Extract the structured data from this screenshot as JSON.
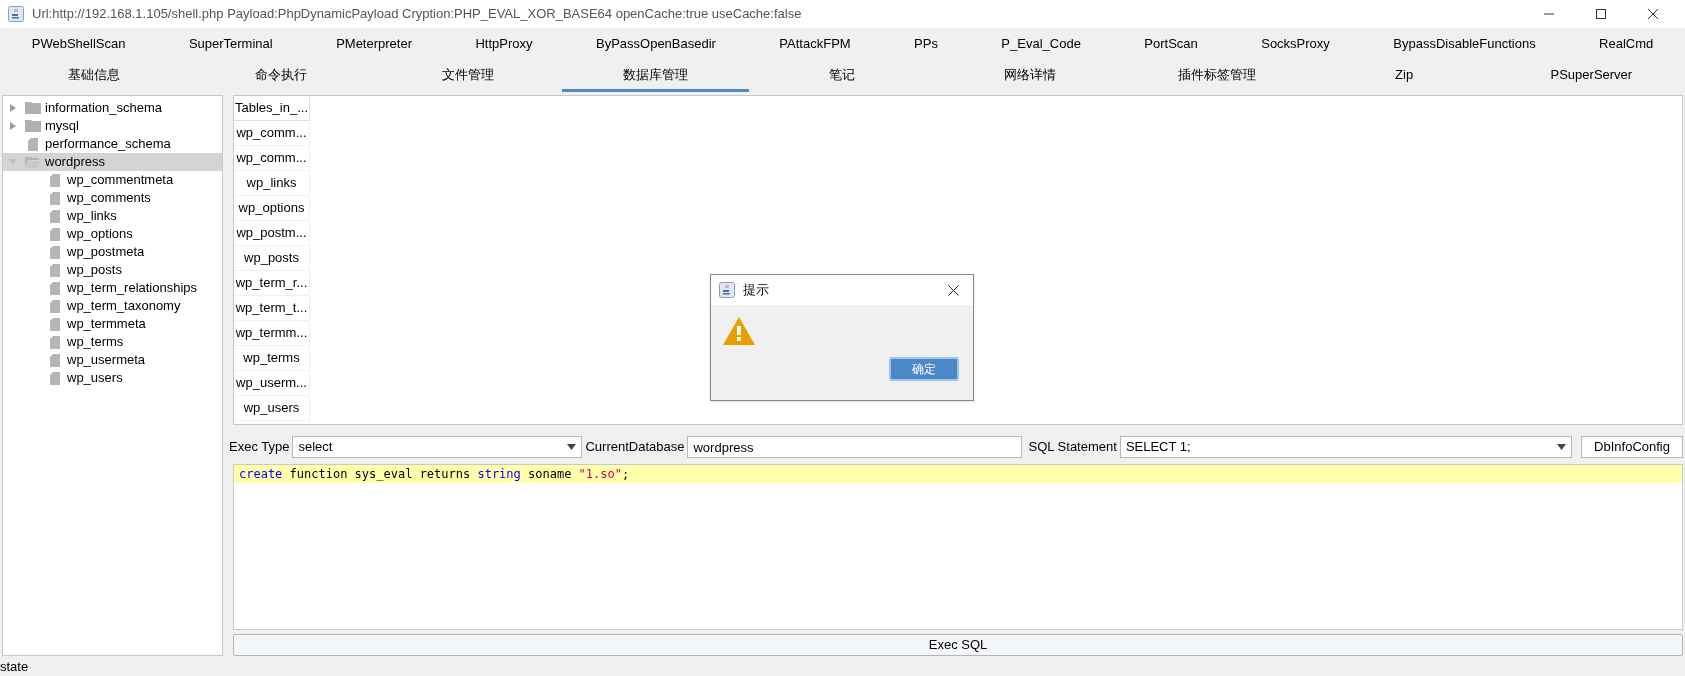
{
  "window": {
    "title": "Url:http://192.168.1.105/shell.php Payload:PhpDynamicPayload Cryption:PHP_EVAL_XOR_BASE64 openCache:true useCache:false"
  },
  "plugin_tabs": [
    {
      "label": "PWebShellScan",
      "selected": false
    },
    {
      "label": "SuperTerminal",
      "selected": false
    },
    {
      "label": "PMeterpreter",
      "selected": false
    },
    {
      "label": "HttpProxy",
      "selected": false
    },
    {
      "label": "ByPassOpenBasedir",
      "selected": false
    },
    {
      "label": "PAttackFPM",
      "selected": false
    },
    {
      "label": "PPs",
      "selected": false
    },
    {
      "label": "P_Eval_Code",
      "selected": false
    },
    {
      "label": "PortScan",
      "selected": false
    },
    {
      "label": "SocksProxy",
      "selected": false
    },
    {
      "label": "BypassDisableFunctions",
      "selected": false
    },
    {
      "label": "RealCmd",
      "selected": false
    }
  ],
  "tabs": [
    {
      "label": "基础信息",
      "selected": false
    },
    {
      "label": "命令执行",
      "selected": false
    },
    {
      "label": "文件管理",
      "selected": false
    },
    {
      "label": "数据库管理",
      "selected": true
    },
    {
      "label": "笔记",
      "selected": false
    },
    {
      "label": "网络详情",
      "selected": false
    },
    {
      "label": "插件标签管理",
      "selected": false
    },
    {
      "label": "Zip",
      "selected": false
    },
    {
      "label": "PSuperServer",
      "selected": false
    }
  ],
  "tree": [
    {
      "label": "information_schema",
      "kind": "folder",
      "expanded": false,
      "selected": false
    },
    {
      "label": "mysql",
      "kind": "folder",
      "expanded": false,
      "selected": false
    },
    {
      "label": "performance_schema",
      "kind": "file",
      "selected": false
    },
    {
      "label": "wordpress",
      "kind": "folder",
      "expanded": true,
      "selected": true,
      "children": [
        {
          "label": "wp_commentmeta",
          "kind": "file",
          "selected": false
        },
        {
          "label": "wp_comments",
          "kind": "file",
          "selected": false
        },
        {
          "label": "wp_links",
          "kind": "file",
          "selected": false
        },
        {
          "label": "wp_options",
          "kind": "file",
          "selected": false
        },
        {
          "label": "wp_postmeta",
          "kind": "file",
          "selected": false
        },
        {
          "label": "wp_posts",
          "kind": "file",
          "selected": false
        },
        {
          "label": "wp_term_relationships",
          "kind": "file",
          "selected": false
        },
        {
          "label": "wp_term_taxonomy",
          "kind": "file",
          "selected": false
        },
        {
          "label": "wp_termmeta",
          "kind": "file",
          "selected": false
        },
        {
          "label": "wp_terms",
          "kind": "file",
          "selected": false
        },
        {
          "label": "wp_usermeta",
          "kind": "file",
          "selected": false
        },
        {
          "label": "wp_users",
          "kind": "file",
          "selected": false
        }
      ]
    }
  ],
  "table": {
    "columns": [
      "Tables_in_..."
    ],
    "rows": [
      "wp_comm...",
      "wp_comm...",
      "wp_links",
      "wp_options",
      "wp_postm...",
      "wp_posts",
      "wp_term_r...",
      "wp_term_t...",
      "wp_termm...",
      "wp_terms",
      "wp_userm...",
      "wp_users"
    ]
  },
  "controls": {
    "exec_type_label": "Exec Type",
    "exec_type": "select",
    "database_label": "CurrentDatabase",
    "database": "wordpress",
    "sql_label": "SQL Statement",
    "sql": "SELECT 1;",
    "config_button": "DbInfoConfig"
  },
  "editor": {
    "tokens": [
      {
        "text": "create",
        "kind": "keyword"
      },
      {
        "text": " function sys_eval returns ",
        "kind": "plain"
      },
      {
        "text": "string",
        "kind": "keyword"
      },
      {
        "text": " soname ",
        "kind": "plain"
      },
      {
        "text": "\"1.so\"",
        "kind": "string"
      },
      {
        "text": ";",
        "kind": "plain"
      }
    ]
  },
  "exec_button": "Exec SQL",
  "status_bar": "state",
  "dialog": {
    "title": "提示",
    "ok_button": "确定"
  }
}
